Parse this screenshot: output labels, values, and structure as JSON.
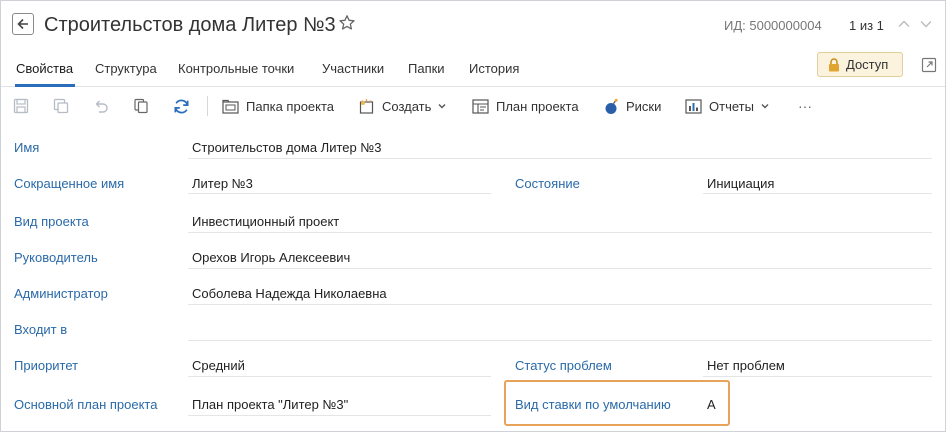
{
  "header": {
    "title": "Строительстов дома Литер №3",
    "id_label": "ИД: 5000000004",
    "pager": "1 из 1"
  },
  "tabs": [
    {
      "label": "Свойства",
      "active": true
    },
    {
      "label": "Структура"
    },
    {
      "label": "Контрольные точки"
    },
    {
      "label": "Участники"
    },
    {
      "label": "Папки"
    },
    {
      "label": "История"
    }
  ],
  "access_button": {
    "label": "Доступ"
  },
  "toolbar": {
    "folder": "Папка проекта",
    "create": "Создать",
    "plan": "План проекта",
    "risks": "Риски",
    "reports": "Отчеты",
    "more": "···"
  },
  "fields": {
    "name": {
      "label": "Имя",
      "value": "Строительстов дома Литер №3"
    },
    "short_name": {
      "label": "Сокращенное имя",
      "value": "Литер №3"
    },
    "state": {
      "label": "Состояние",
      "value": "Инициация"
    },
    "project_type": {
      "label": "Вид проекта",
      "value": "Инвестиционный проект"
    },
    "manager": {
      "label": "Руководитель",
      "value": "Орехов Игорь Алексеевич"
    },
    "admin": {
      "label": "Администратор",
      "value": "Соболева Надежда Николаевна"
    },
    "parent": {
      "label": "Входит в",
      "value": ""
    },
    "priority": {
      "label": "Приоритет",
      "value": "Средний"
    },
    "problem_status": {
      "label": "Статус проблем",
      "value": "Нет проблем"
    },
    "baseline": {
      "label": "Основной план проекта",
      "value": "План проекта \"Литер №3\""
    },
    "rate_type": {
      "label": "Вид ставки по умолчанию",
      "value": "А"
    }
  },
  "colors": {
    "accent": "#2a6ebb",
    "label": "#2a6aa8",
    "highlight": "#e7a35a",
    "access_bg": "#fbf3dd"
  }
}
